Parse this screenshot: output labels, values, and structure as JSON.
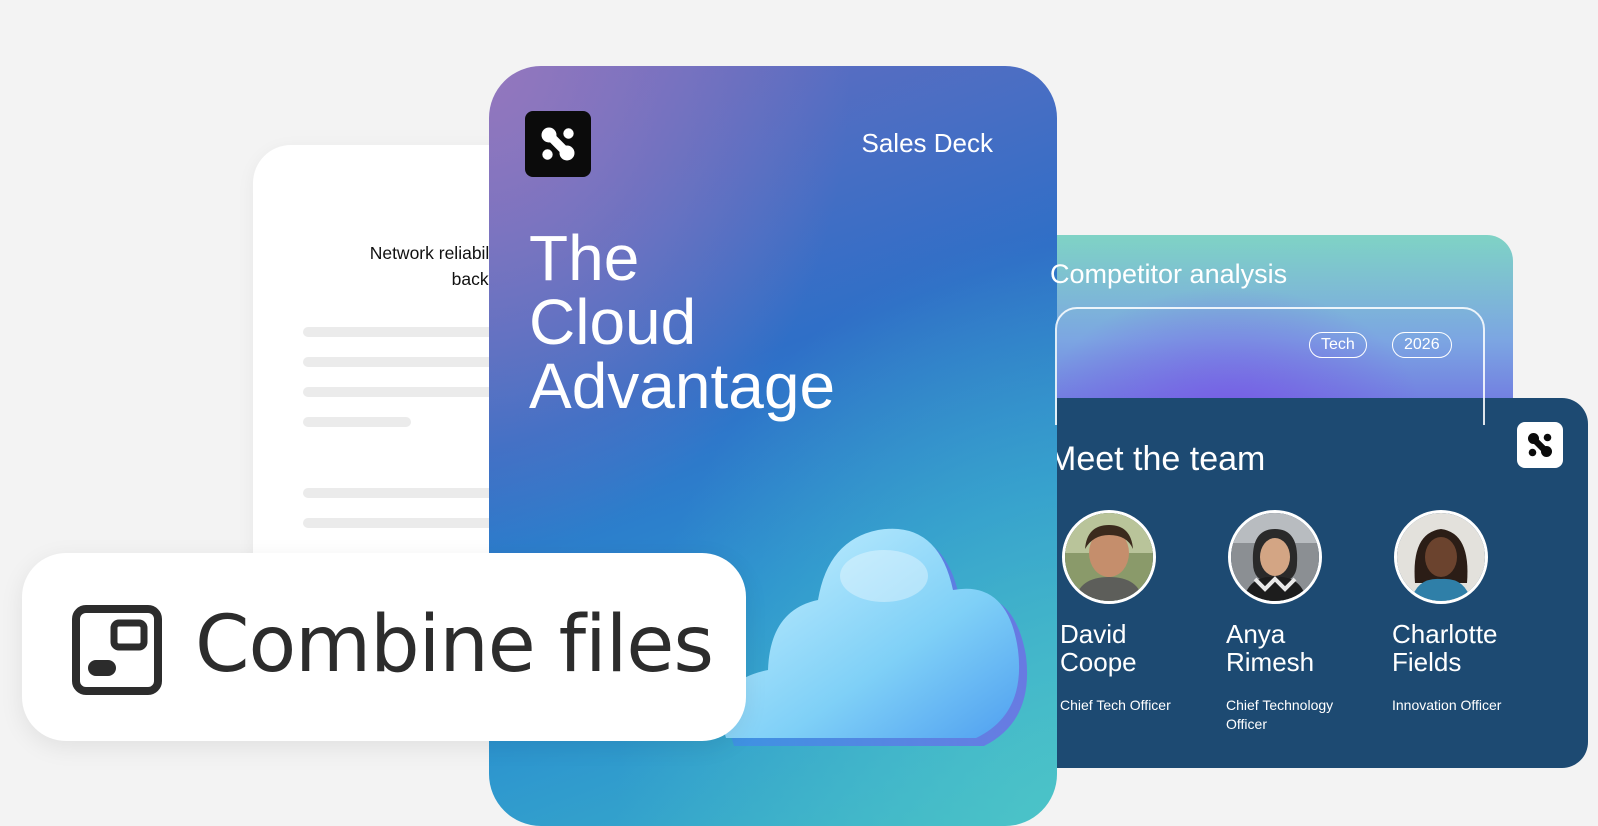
{
  "document": {
    "heading_line1": "Network reliability th",
    "heading_line2": "backed wit"
  },
  "hero": {
    "tag": "Sales Deck",
    "title_line1": "The",
    "title_line2": "Cloud",
    "title_line3": "Advantage",
    "logo_icon": "brand-logo-icon",
    "illustration_icon": "cloud-icon"
  },
  "competitor": {
    "title": "Competitor analysis",
    "tags": [
      "Tech",
      "2026"
    ]
  },
  "team": {
    "title": "Meet the team",
    "logo_icon": "brand-logo-icon",
    "members": [
      {
        "name": "David\nCoope",
        "role": "Chief Tech Officer",
        "avatar": "person-photo"
      },
      {
        "name": "Anya\nRimesh",
        "role": "Chief Technology Officer",
        "avatar": "person-photo"
      },
      {
        "name": "Charlotte\nFields",
        "role": "Innovation Officer",
        "avatar": "person-photo"
      }
    ]
  },
  "banner": {
    "label": "Combine files",
    "icon": "combine-files-icon"
  },
  "colors": {
    "background": "#f3f3f3",
    "team_card": "#1d4a72",
    "hero_blue": "#2f6fc7",
    "banner_text": "#2c2c2c"
  }
}
